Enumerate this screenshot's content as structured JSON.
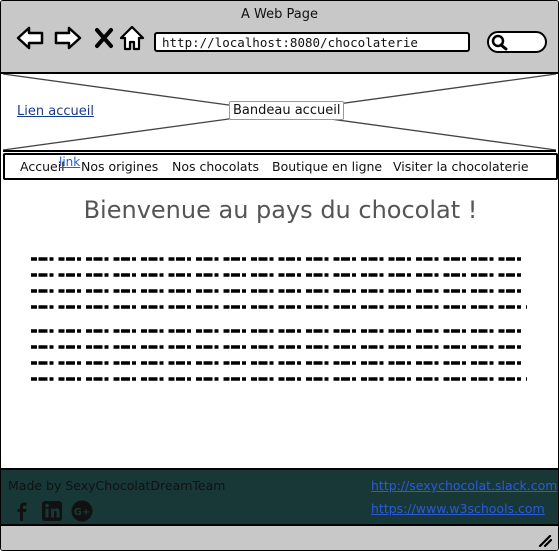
{
  "window": {
    "title": "A Web Page",
    "url": "http://localhost:8080/chocolaterie"
  },
  "icons": [
    "back-arrow-icon",
    "forward-arrow-icon",
    "close-icon",
    "home-icon",
    "search-icon"
  ],
  "banner": {
    "home_link": "Lien accueil",
    "label": "Bandeau accueil"
  },
  "menu": {
    "items": [
      "Accueil",
      "Nos origines",
      "Nos chocolats",
      "Boutique en ligne",
      "Visiter la chocolaterie"
    ],
    "link_badge": "link"
  },
  "main": {
    "headline": "Bienvenue au pays du chocolat !"
  },
  "footer": {
    "made_by": "Made by SexyChocolatDreamTeam",
    "links": [
      "http://sexychocolat.slack.com",
      "https://www.w3schools.com"
    ],
    "social_icons": [
      "facebook-icon",
      "linkedin-icon",
      "google-plus-icon"
    ]
  },
  "colors": {
    "chrome": "#c8c8c8",
    "footer_bg": "#183838",
    "link": "#2a5bd8",
    "headline": "#555555"
  }
}
